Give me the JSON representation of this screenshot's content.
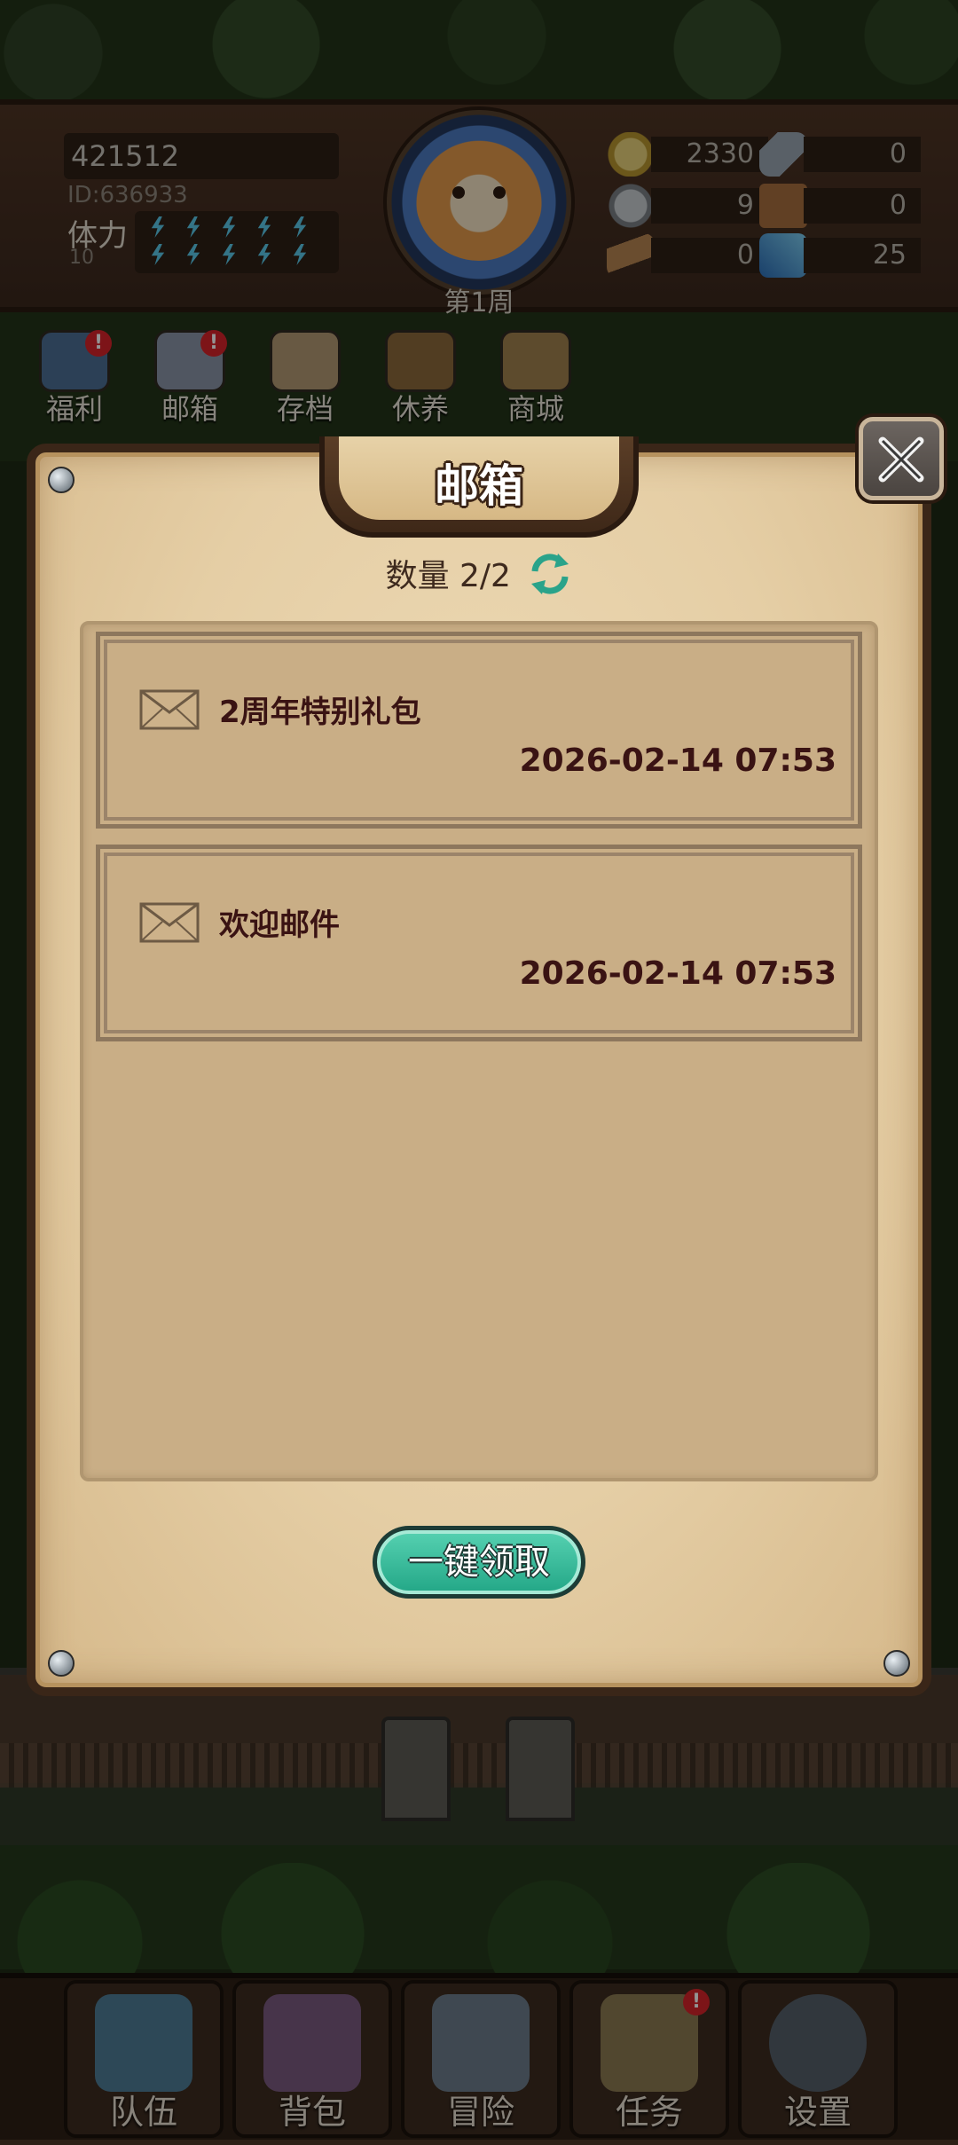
{
  "player": {
    "name_value": "421512",
    "uid": "ID:636933",
    "stamina_label": "体力",
    "stamina_value": "10",
    "week_label": "第1周"
  },
  "resources": [
    {
      "icon": "gold-coin-icon",
      "value": "2330"
    },
    {
      "icon": "iron-ingot-icon",
      "value": "0"
    },
    {
      "icon": "stone-ore-icon",
      "value": "9"
    },
    {
      "icon": "leather-hide-icon",
      "value": "0"
    },
    {
      "icon": "wood-log-icon",
      "value": "0"
    },
    {
      "icon": "blue-crystal-icon",
      "value": "25"
    }
  ],
  "quick_nav": [
    {
      "label": "福利",
      "icon": "welfare-shield-icon",
      "badge": "!"
    },
    {
      "label": "邮箱",
      "icon": "mailbox-icon",
      "badge": "!"
    },
    {
      "label": "存档",
      "icon": "save-scroll-icon",
      "badge": ""
    },
    {
      "label": "休养",
      "icon": "rest-chest-icon",
      "badge": ""
    },
    {
      "label": "商城",
      "icon": "shop-bag-icon",
      "badge": ""
    }
  ],
  "mailbox": {
    "title": "邮箱",
    "count_text": "数量 2/2",
    "mails": [
      {
        "subject": "2周年特别礼包",
        "date": "2026-02-14 07:53"
      },
      {
        "subject": "欢迎邮件",
        "date": "2026-02-14 07:53"
      }
    ],
    "claim_all_label": "一键领取"
  },
  "bottom_nav": [
    {
      "label": "队伍",
      "icon": "helmet-icon",
      "badge": ""
    },
    {
      "label": "背包",
      "icon": "backpack-icon",
      "badge": ""
    },
    {
      "label": "冒险",
      "icon": "crossed-swords-icon",
      "badge": ""
    },
    {
      "label": "任务",
      "icon": "quest-scroll-icon",
      "badge": "!"
    },
    {
      "label": "设置",
      "icon": "gear-icon",
      "badge": ""
    }
  ],
  "colors": {
    "accent_green": "#22a686",
    "text_dark_red": "#3a1313",
    "badge_red": "#d8242a"
  }
}
